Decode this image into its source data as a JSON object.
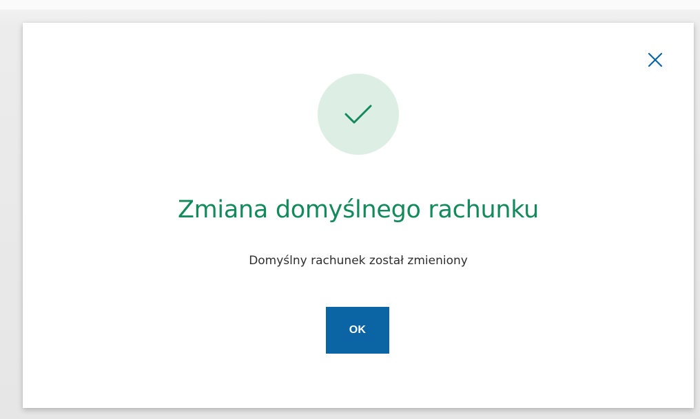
{
  "dialog": {
    "title": "Zmiana domyślnego rachunku",
    "message": "Domyślny rachunek został zmieniony",
    "ok_label": "OK",
    "close_icon": "close-icon",
    "status_icon": "checkmark-icon"
  },
  "colors": {
    "title_green": "#138a5c",
    "check_green": "#138a5c",
    "circle_bg": "#ddefe4",
    "button_blue": "#0b64a4",
    "close_blue": "#0b64a4",
    "text_dark": "#2e2e2e"
  }
}
